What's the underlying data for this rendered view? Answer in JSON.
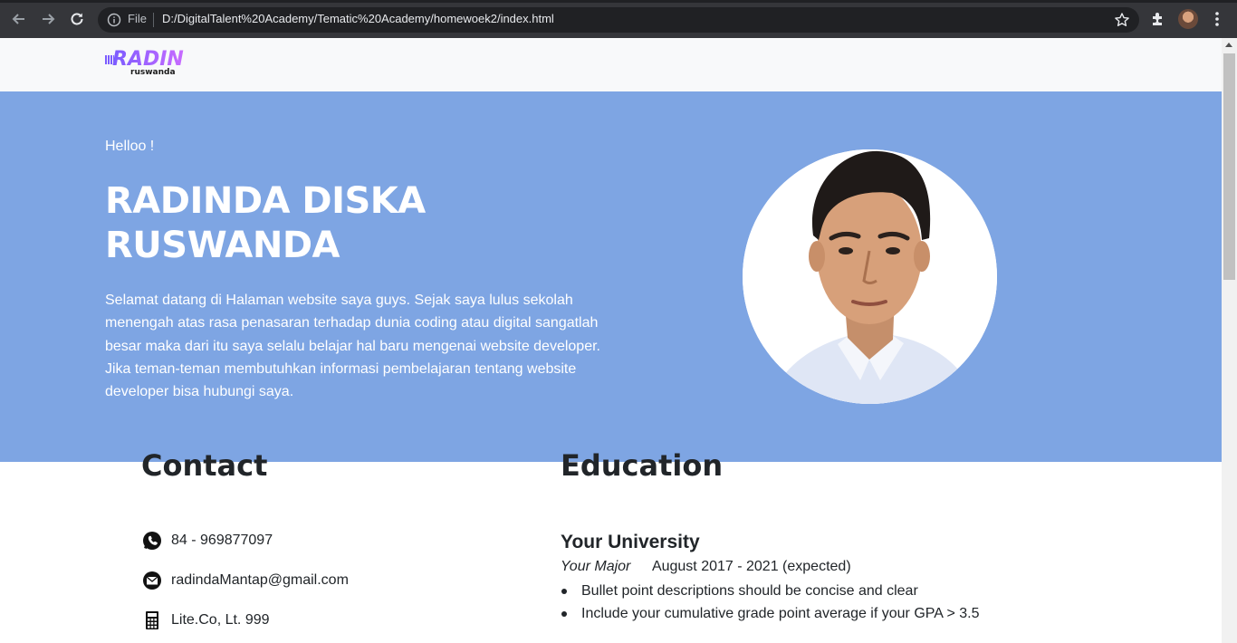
{
  "browser": {
    "file_label": "File",
    "url": "D:/DigitalTalent%20Academy/Tematic%20Academy/homewoek2/index.html",
    "icons": [
      "back-icon",
      "forward-icon",
      "reload-icon",
      "info-icon",
      "star-icon",
      "extensions-icon",
      "profile-avatar",
      "more-menu-icon"
    ]
  },
  "logo": {
    "main": "RADIN",
    "sub": "ruswanda",
    "colors": [
      "#7b5cff",
      "#c86bff"
    ]
  },
  "hero": {
    "greeting": "Helloo !",
    "name": "RADINDA DISKA RUSWANDA",
    "description": "Selamat datang di Halaman website saya guys. Sejak saya lulus sekolah menengah atas rasa penasaran terhadap dunia coding atau digital sangatlah besar maka dari itu saya selalu belajar hal baru mengenai website developer. Jika teman-teman membutuhkan informasi pembelajaran tentang website developer bisa hubungi saya.",
    "background": "#7ea5e3"
  },
  "contact": {
    "title": "Contact",
    "items": [
      {
        "icon": "whatsapp-icon",
        "text": "84 - 969877097"
      },
      {
        "icon": "email-icon",
        "text": "radindaMantap@gmail.com"
      },
      {
        "icon": "building-icon",
        "text": "Lite.Co, Lt. 999"
      }
    ]
  },
  "education": {
    "title": "Education",
    "university": "Your University",
    "major": "Your Major",
    "period": "August 2017 - 2021 (expected)",
    "bullets": [
      "Bullet point descriptions should be concise and clear",
      "Include your cumulative grade point average if your GPA > 3.5"
    ]
  }
}
